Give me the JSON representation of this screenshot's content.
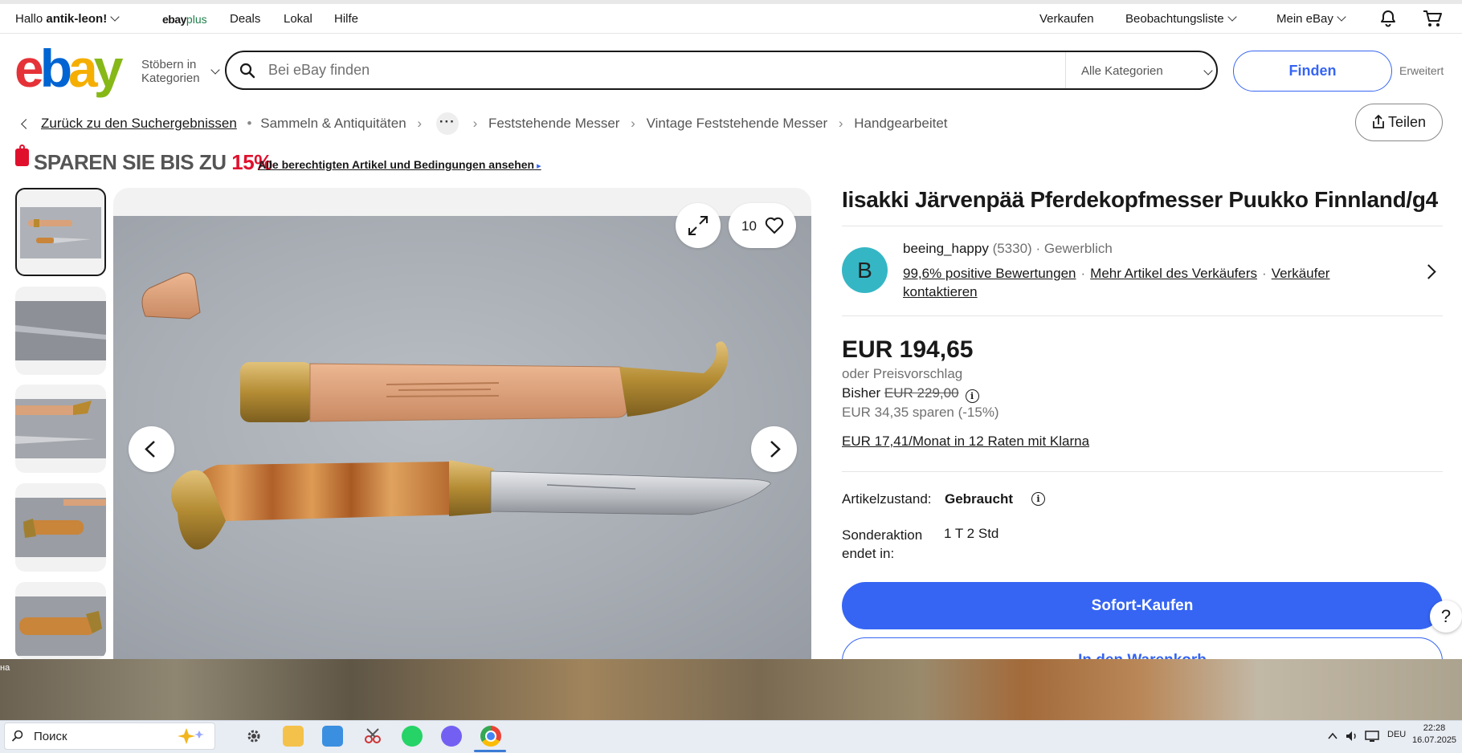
{
  "topbar": {
    "greeting_prefix": "Hallo",
    "username": "antik-leon!",
    "ebayplus_a": "ebay",
    "ebayplus_b": "plus",
    "deals": "Deals",
    "lokal": "Lokal",
    "hilfe": "Hilfe",
    "verkaufen": "Verkaufen",
    "watchlist": "Beobachtungsliste",
    "myebay": "Mein eBay"
  },
  "header": {
    "logo": [
      "e",
      "b",
      "a",
      "y"
    ],
    "browse_line1": "Stöbern in",
    "browse_line2": "Kategorien",
    "search_placeholder": "Bei eBay finden",
    "category": "Alle Kategorien",
    "find_button": "Finden",
    "advanced": "Erweitert"
  },
  "breadcrumb": {
    "back": "Zurück zu den Suchergebnissen",
    "items": [
      "Sammeln & Antiquitäten",
      "Feststehende Messer",
      "Vintage Feststehende Messer",
      "Handgearbeitet"
    ],
    "more": "···",
    "share": "Teilen"
  },
  "promo": {
    "text": "SPAREN SIE BIS ZU",
    "percent": "15%",
    "link": "Alle berechtigten Artikel und Bedingungen ansehen"
  },
  "gallery": {
    "watch_count": "10"
  },
  "item": {
    "title": "Iisakki Järvenpää Pferdekopfmesser Puukko Finnland/g4",
    "seller": {
      "initial": "B",
      "name": "beeing_happy",
      "score": "(5330)",
      "sep": "·",
      "type": "Gewerblich",
      "feedback": "99,6% positive Bewertungen",
      "more_items": "Mehr Artikel des Verkäufers",
      "contact": "Verkäufer kontaktieren"
    },
    "price": "EUR 194,65",
    "offer": "oder Preisvorschlag",
    "was_label": "Bisher",
    "was_price": "EUR 229,00",
    "savings": "EUR 34,35 sparen (-15%)",
    "installments": "EUR 17,41/Monat in 12 Raten mit Klarna",
    "condition_label": "Artikelzustand:",
    "condition_value": "Gebraucht",
    "sale_label": "Sonderaktion endet in:",
    "sale_value": "1 T 2 Std",
    "buy_now": "Sofort-Kaufen",
    "add_to_cart": "In den Warenkorb",
    "help": "?"
  },
  "desktop": {
    "wallpaper_label": "на",
    "taskbar_search": "Поиск",
    "lang": "DEU",
    "time": "22:28",
    "date": "16.07.2025"
  },
  "colors": {
    "accent": "#3665f3",
    "promo_red": "#e0102d",
    "avatar": "#35b6c5"
  }
}
